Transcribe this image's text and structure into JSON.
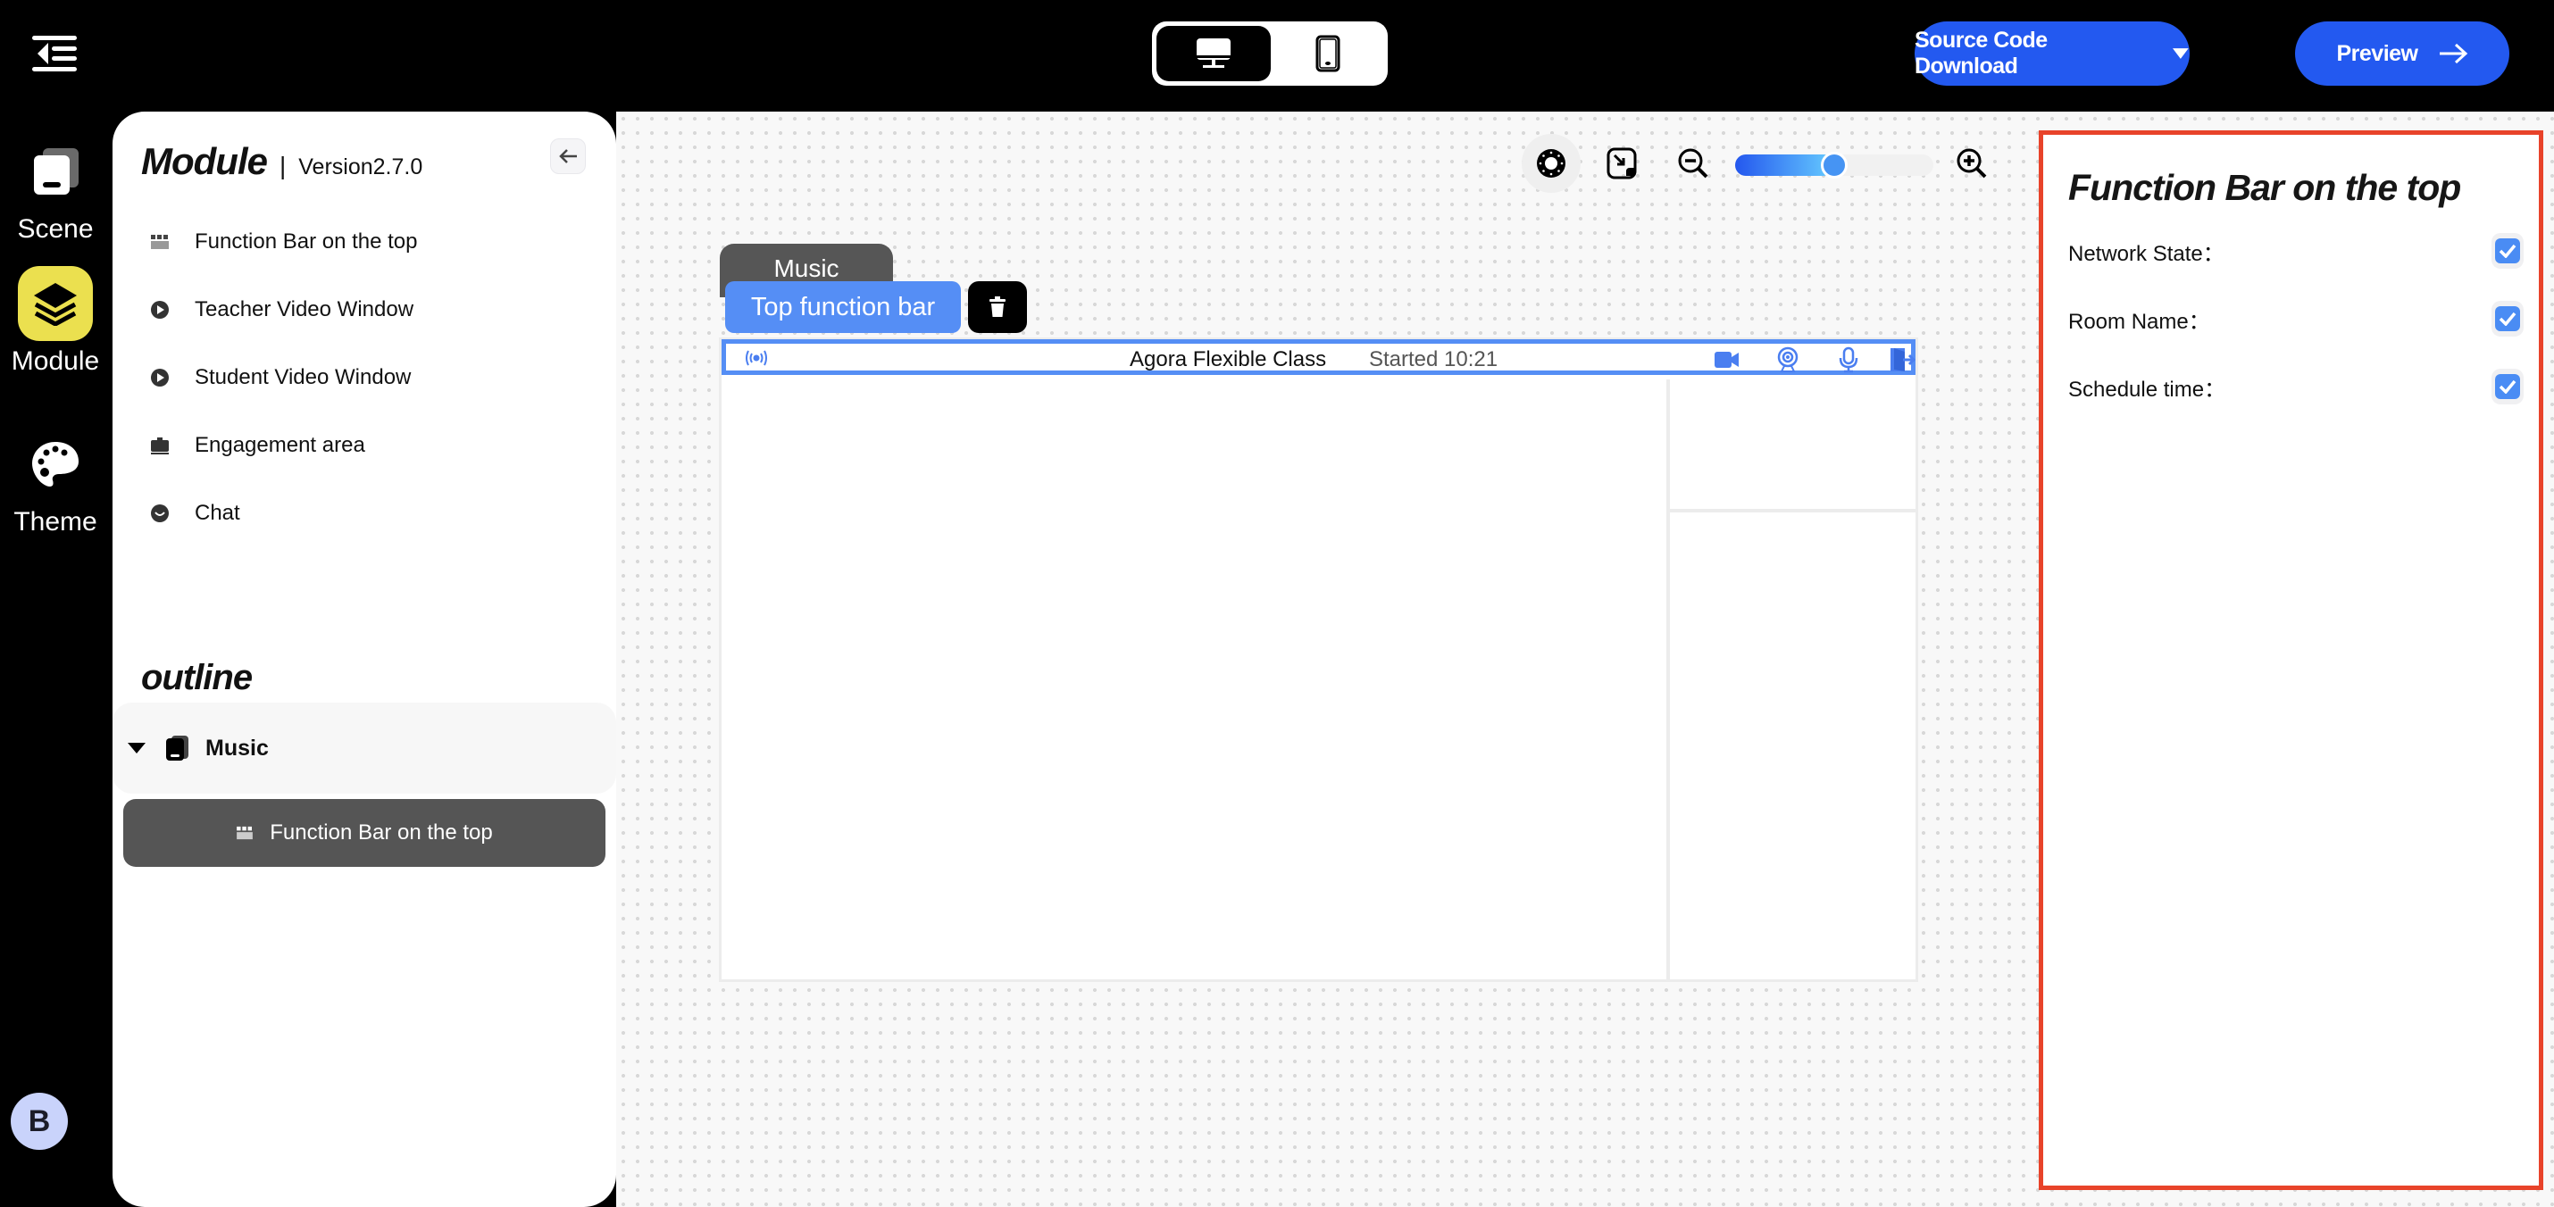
{
  "topbar": {
    "menu_icon": "collapse-menu-icon",
    "device_toggle": {
      "desktop_icon": "desktop-icon",
      "mobile_icon": "mobile-icon",
      "selected": "desktop"
    },
    "source_code_download_label": "Source Code Download",
    "preview_label": "Preview"
  },
  "rail": {
    "items": [
      {
        "label": "Scene",
        "icon": "scene-icon",
        "active": false
      },
      {
        "label": "Module",
        "icon": "layers-icon",
        "active": true
      },
      {
        "label": "Theme",
        "icon": "palette-icon",
        "active": false
      }
    ],
    "avatar_initial": "B"
  },
  "left_panel": {
    "title": "Module",
    "separator": "|",
    "version": "Version2.7.0",
    "modules": [
      {
        "label": "Function Bar on the top",
        "icon": "function-bar-icon"
      },
      {
        "label": "Teacher Video Window",
        "icon": "play-icon"
      },
      {
        "label": "Student Video Window",
        "icon": "play-icon"
      },
      {
        "label": "Engagement area",
        "icon": "briefcase-icon"
      },
      {
        "label": "Chat",
        "icon": "chat-icon"
      }
    ],
    "outline_title": "outline",
    "outline_scene": "Music",
    "outline_selected": "Function Bar on the top"
  },
  "canvas": {
    "zoom_level_fraction": 0.5,
    "scene_tab": "Music",
    "selection_label": "Top function bar",
    "function_bar": {
      "room_name": "Agora Flexible Class",
      "schedule_time": "Started 10:21"
    }
  },
  "right_panel": {
    "title": "Function Bar on the top",
    "options": [
      {
        "label": "Network State：",
        "checked": true
      },
      {
        "label": "Room Name：",
        "checked": true
      },
      {
        "label": "Schedule time：",
        "checked": true
      }
    ]
  },
  "colors": {
    "accent_blue": "#2359f0",
    "selection_blue": "#558ef5",
    "module_active_yellow": "#ebe04f",
    "panel_border_red": "#e8432a"
  }
}
